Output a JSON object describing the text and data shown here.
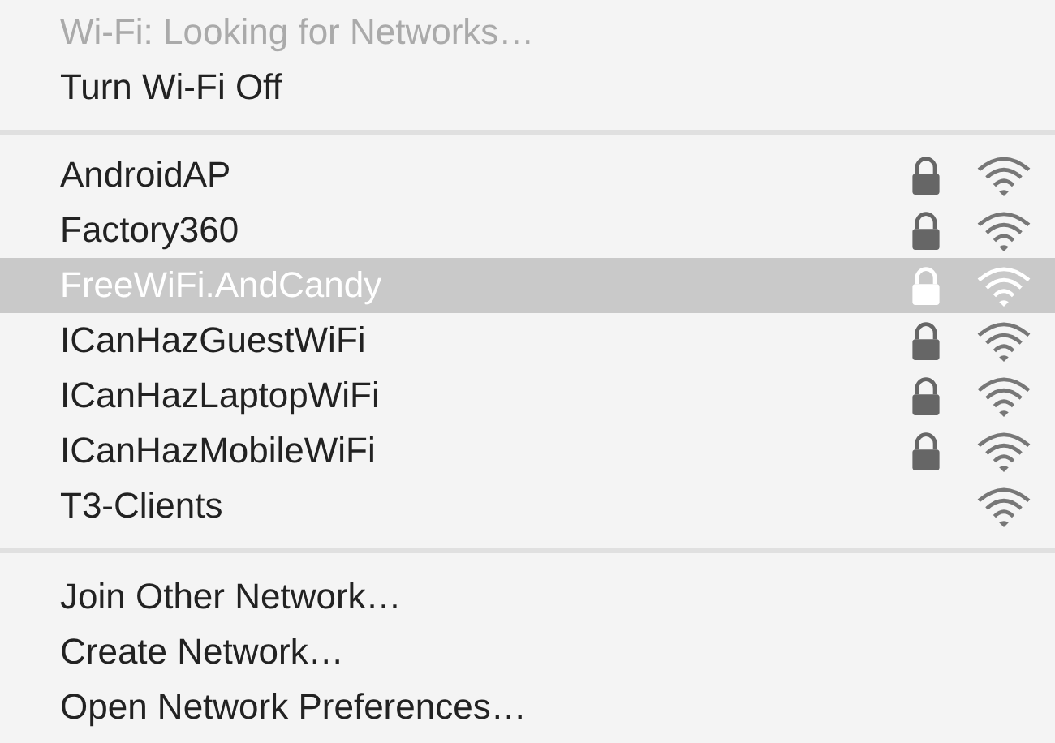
{
  "status": {
    "label": "Wi-Fi: Looking for Networks…",
    "disabled": true
  },
  "toggle": {
    "label": "Turn Wi-Fi Off"
  },
  "networks": [
    {
      "name": "AndroidAP",
      "locked": true,
      "selected": false
    },
    {
      "name": "Factory360",
      "locked": true,
      "selected": false
    },
    {
      "name": "FreeWiFi.AndCandy",
      "locked": true,
      "selected": true
    },
    {
      "name": "ICanHazGuestWiFi",
      "locked": true,
      "selected": false
    },
    {
      "name": "ICanHazLaptopWiFi",
      "locked": true,
      "selected": false
    },
    {
      "name": "ICanHazMobileWiFi",
      "locked": true,
      "selected": false
    },
    {
      "name": "T3-Clients",
      "locked": false,
      "selected": false
    }
  ],
  "actions": [
    "Join Other Network…",
    "Create Network…",
    "Open Network Preferences…"
  ]
}
